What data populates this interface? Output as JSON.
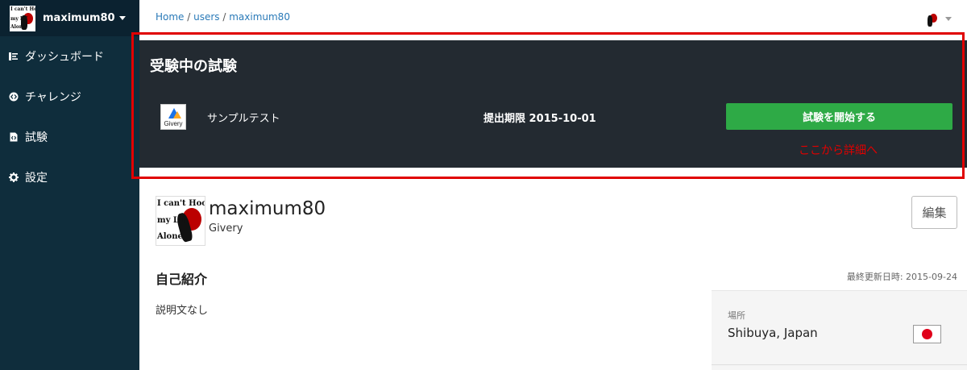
{
  "sidebar": {
    "username": "maximum80",
    "items": [
      {
        "label": "ダッシュボード"
      },
      {
        "label": "チャレンジ"
      },
      {
        "label": "試験"
      },
      {
        "label": "設定"
      }
    ]
  },
  "breadcrumb": {
    "home": "Home",
    "sep": " / ",
    "users": "users",
    "current": "maximum80"
  },
  "exam_panel": {
    "title": "受験中の試験",
    "logo_text": "Givery",
    "exam_name": "サンプルテスト",
    "deadline": "提出期限 2015-10-01",
    "start_button": "試験を開始する",
    "annotation": "ここから詳細へ"
  },
  "avatar_art_text": [
    "I can't Hook",
    "my Lif",
    "Alone"
  ],
  "profile": {
    "name": "maximum80",
    "company": "Givery",
    "edit_button": "編集"
  },
  "bio": {
    "heading": "自己紹介",
    "updated": "最終更新日時: 2015-09-24",
    "text": "説明文なし"
  },
  "location": {
    "label": "場所",
    "value": "Shibuya, Japan",
    "flag": "japan-flag"
  },
  "colors": {
    "sidebar_bg": "#0f2d3c",
    "panel_bg": "#232a31",
    "accent_green": "#2eaa46",
    "link_blue": "#2a7ab8",
    "annotation_red": "#e00000"
  }
}
